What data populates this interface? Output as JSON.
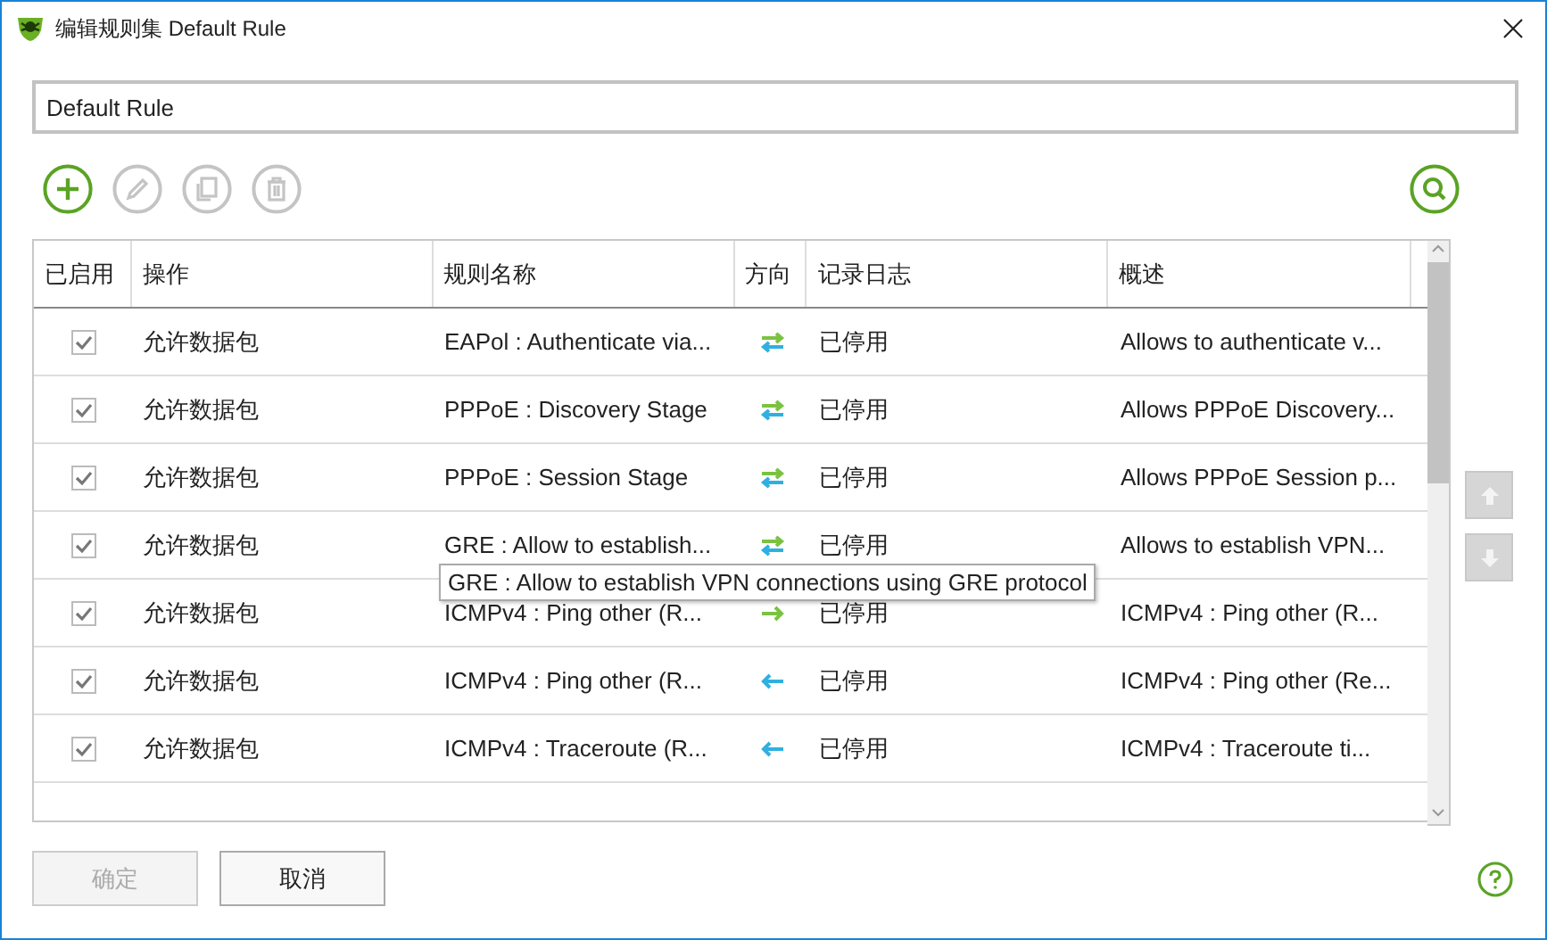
{
  "window": {
    "title": "编辑规则集 Default Rule"
  },
  "name_field": {
    "value": "Default Rule"
  },
  "toolbar": [
    {
      "kind": "add",
      "disabled": false
    },
    {
      "kind": "edit",
      "disabled": true
    },
    {
      "kind": "copy",
      "disabled": true
    },
    {
      "kind": "delete",
      "disabled": true
    }
  ],
  "table": {
    "columns": [
      "已启用",
      "操作",
      "规则名称",
      "方向",
      "记录日志",
      "概述"
    ],
    "rows": [
      {
        "checked": true,
        "action": "允许数据包",
        "name": "EAPol : Authenticate via...",
        "direction": {
          "kind": "both"
        },
        "log": "已停用",
        "summary": "Allows to authenticate v..."
      },
      {
        "checked": true,
        "action": "允许数据包",
        "name": "PPPoE : Discovery Stage",
        "direction": {
          "kind": "both"
        },
        "log": "已停用",
        "summary": "Allows PPPoE Discovery..."
      },
      {
        "checked": true,
        "action": "允许数据包",
        "name": "PPPoE : Session Stage",
        "direction": {
          "kind": "both"
        },
        "log": "已停用",
        "summary": "Allows PPPoE Session p..."
      },
      {
        "checked": true,
        "action": "允许数据包",
        "name": "GRE : Allow to establish...",
        "direction": {
          "kind": "both"
        },
        "log": "已停用",
        "summary": "Allows to establish VPN..."
      },
      {
        "checked": true,
        "action": "允许数据包",
        "name": "ICMPv4 : Ping other (R...",
        "direction": {
          "kind": "out"
        },
        "log": "已停用",
        "summary": "ICMPv4 : Ping other (R..."
      },
      {
        "checked": true,
        "action": "允许数据包",
        "name": "ICMPv4 : Ping other (R...",
        "direction": {
          "kind": "in"
        },
        "log": "已停用",
        "summary": "ICMPv4 : Ping other (Re..."
      },
      {
        "checked": true,
        "action": "允许数据包",
        "name": "ICMPv4 : Traceroute (R...",
        "direction": {
          "kind": "in"
        },
        "log": "已停用",
        "summary": "ICMPv4 : Traceroute ti..."
      }
    ],
    "tooltip": "GRE : Allow to establish VPN connections using GRE protocol"
  },
  "buttons": [
    {
      "label": "确定",
      "disabled": true
    },
    {
      "label": "取消",
      "disabled": false
    }
  ]
}
